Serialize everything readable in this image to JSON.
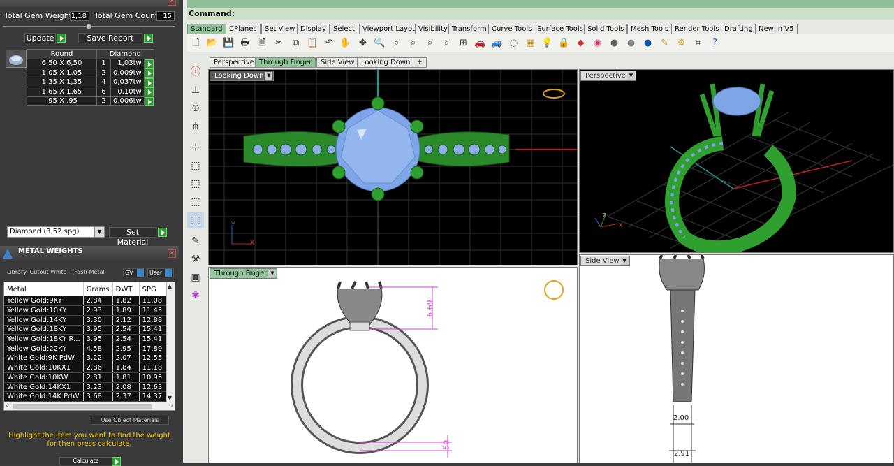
{
  "gem_reporter": {
    "total_gem_weight_label": "Total Gem Weight",
    "total_gem_weight_value": "1,18",
    "total_gem_count_label": "Total Gem Count",
    "total_gem_count_value": "15",
    "update_label": "Update",
    "save_report_label": "Save Report",
    "headers": [
      "Round",
      "Diamond"
    ],
    "rows": [
      {
        "size": "6,50 X 6,50",
        "count": "1",
        "weight": "1,03tw"
      },
      {
        "size": "1,05 X 1,05",
        "count": "2",
        "weight": "0,009tw"
      },
      {
        "size": "1,35 X 1,35",
        "count": "4",
        "weight": "0,037tw"
      },
      {
        "size": "1,65 X 1,65",
        "count": "6",
        "weight": "0,10tw"
      },
      {
        "size": ",95 X ,95",
        "count": "2",
        "weight": "0,006tw"
      }
    ],
    "material_select": "Diamond   (3,52 spg)",
    "set_material_label": "Set Material"
  },
  "metal_weights": {
    "title": "METAL WEIGHTS",
    "library": "Library: Cutout White - (Fasti-Metal",
    "gv_label": "GV",
    "user_label": "User",
    "columns": [
      "Metal",
      "Grams",
      "DWT",
      "SPG"
    ],
    "rows": [
      [
        "Yellow Gold:9KY",
        "2.84",
        "1.82",
        "11.08"
      ],
      [
        "Yellow Gold:10KY",
        "2.93",
        "1.89",
        "11.45"
      ],
      [
        "Yellow Gold:14KY",
        "3.30",
        "2.12",
        "12.88"
      ],
      [
        "Yellow Gold:18KY",
        "3.95",
        "2.54",
        "15.41"
      ],
      [
        "Yellow Gold:18KY R...",
        "3.95",
        "2.54",
        "15.41"
      ],
      [
        "Yellow Gold:22KY",
        "4.58",
        "2.95",
        "17.89"
      ],
      [
        "White Gold:9K PdW",
        "3.22",
        "2.07",
        "12.55"
      ],
      [
        "White Gold:10KX1",
        "2.86",
        "1.84",
        "11.18"
      ],
      [
        "White Gold:10KW",
        "2.81",
        "1.81",
        "10.95"
      ],
      [
        "White Gold:14KX1",
        "3.23",
        "2.08",
        "12.63"
      ],
      [
        "White Gold:14K PdW",
        "3.68",
        "2.37",
        "14.37"
      ]
    ],
    "use_object_materials": "Use Object Materials",
    "note": "Highlight the item you want to find the weight for then press calculate.",
    "calculate_label": "Calculate"
  },
  "command": {
    "label": "Command:"
  },
  "toolbar_tabs": [
    "Standard",
    "CPlanes",
    "Set View",
    "Display",
    "Select",
    "Viewport Layout",
    "Visibility",
    "Transform",
    "Curve Tools",
    "Surface Tools",
    "Solid Tools",
    "Mesh Tools",
    "Render Tools",
    "Drafting",
    "New in V5"
  ],
  "view_tabs": [
    "Perspective",
    "Through Finger",
    "Side View",
    "Looking Down",
    "+"
  ],
  "viewports": {
    "looking_down": "Looking Down",
    "perspective": "Perspective",
    "through_finger": "Through Finger",
    "side_view": "Side View"
  },
  "dimensions": {
    "height": "6.69",
    "bottom": ".50",
    "width_top": "2.00",
    "width_bottom": "2.91"
  },
  "axis": {
    "x": "X",
    "y": "Y",
    "z": "Z"
  }
}
